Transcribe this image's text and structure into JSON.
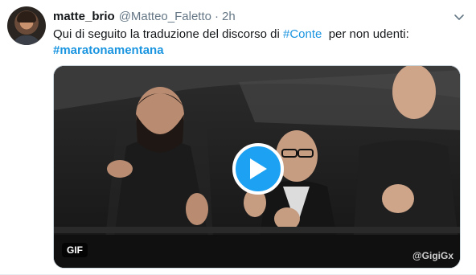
{
  "tweet": {
    "author_name": "matte_brio",
    "author_handle": "@Matteo_Faletto",
    "separator": "·",
    "timestamp": "2h",
    "text_before": "Qui di seguito la traduzione del discorso di ",
    "hashtag_1": "#Conte",
    "text_after": "  per non udenti:",
    "hashtag_2": "#maratonamentana"
  },
  "media": {
    "badge": "GIF",
    "watermark": "@GigiGx"
  },
  "icons": {
    "menu": "chevron-down-icon",
    "play": "play-icon"
  },
  "colors": {
    "link": "#1b95e0",
    "play_button": "#1da1f2",
    "secondary_text": "#657786"
  }
}
